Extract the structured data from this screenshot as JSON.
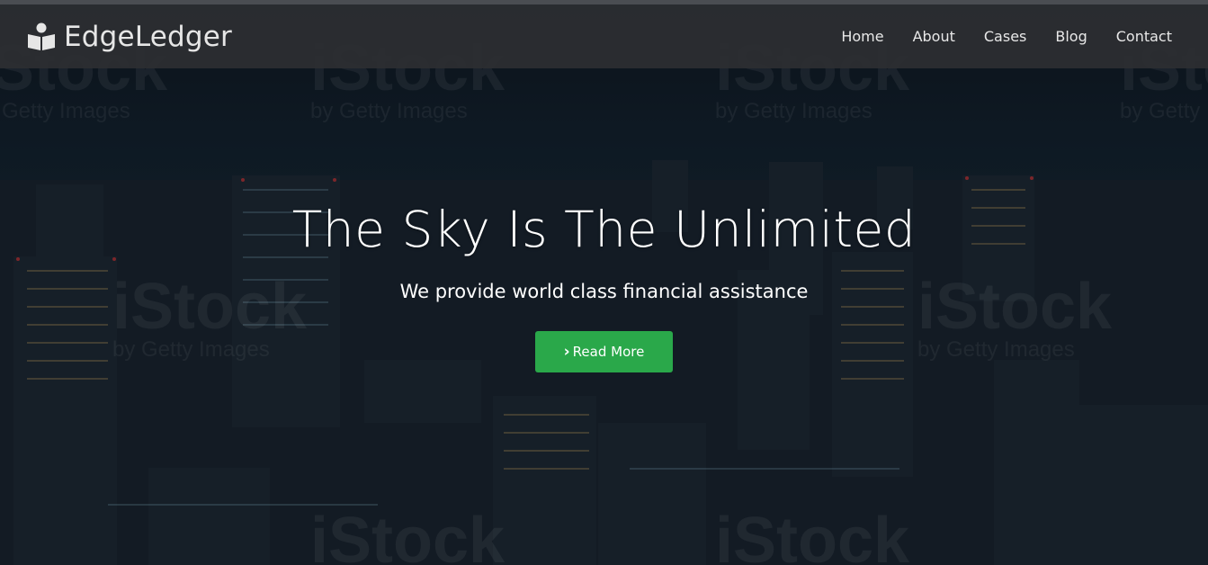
{
  "brand": {
    "name": "EdgeLedger",
    "icon": "person-book-icon"
  },
  "nav": {
    "items": [
      {
        "label": "Home"
      },
      {
        "label": "About"
      },
      {
        "label": "Cases"
      },
      {
        "label": "Blog"
      },
      {
        "label": "Contact"
      }
    ]
  },
  "hero": {
    "title": "The Sky Is The Unlimited",
    "subtitle": "We provide world class financial assistance",
    "cta": {
      "label": "Read More",
      "icon": "chevron-right-icon",
      "color": "#2aa84a"
    }
  },
  "watermark": {
    "brand": "iStock",
    "by": "by Getty Images"
  },
  "colors": {
    "navbar": "#2d2f32",
    "accent": "#2aa84a",
    "text": "#ffffff"
  }
}
